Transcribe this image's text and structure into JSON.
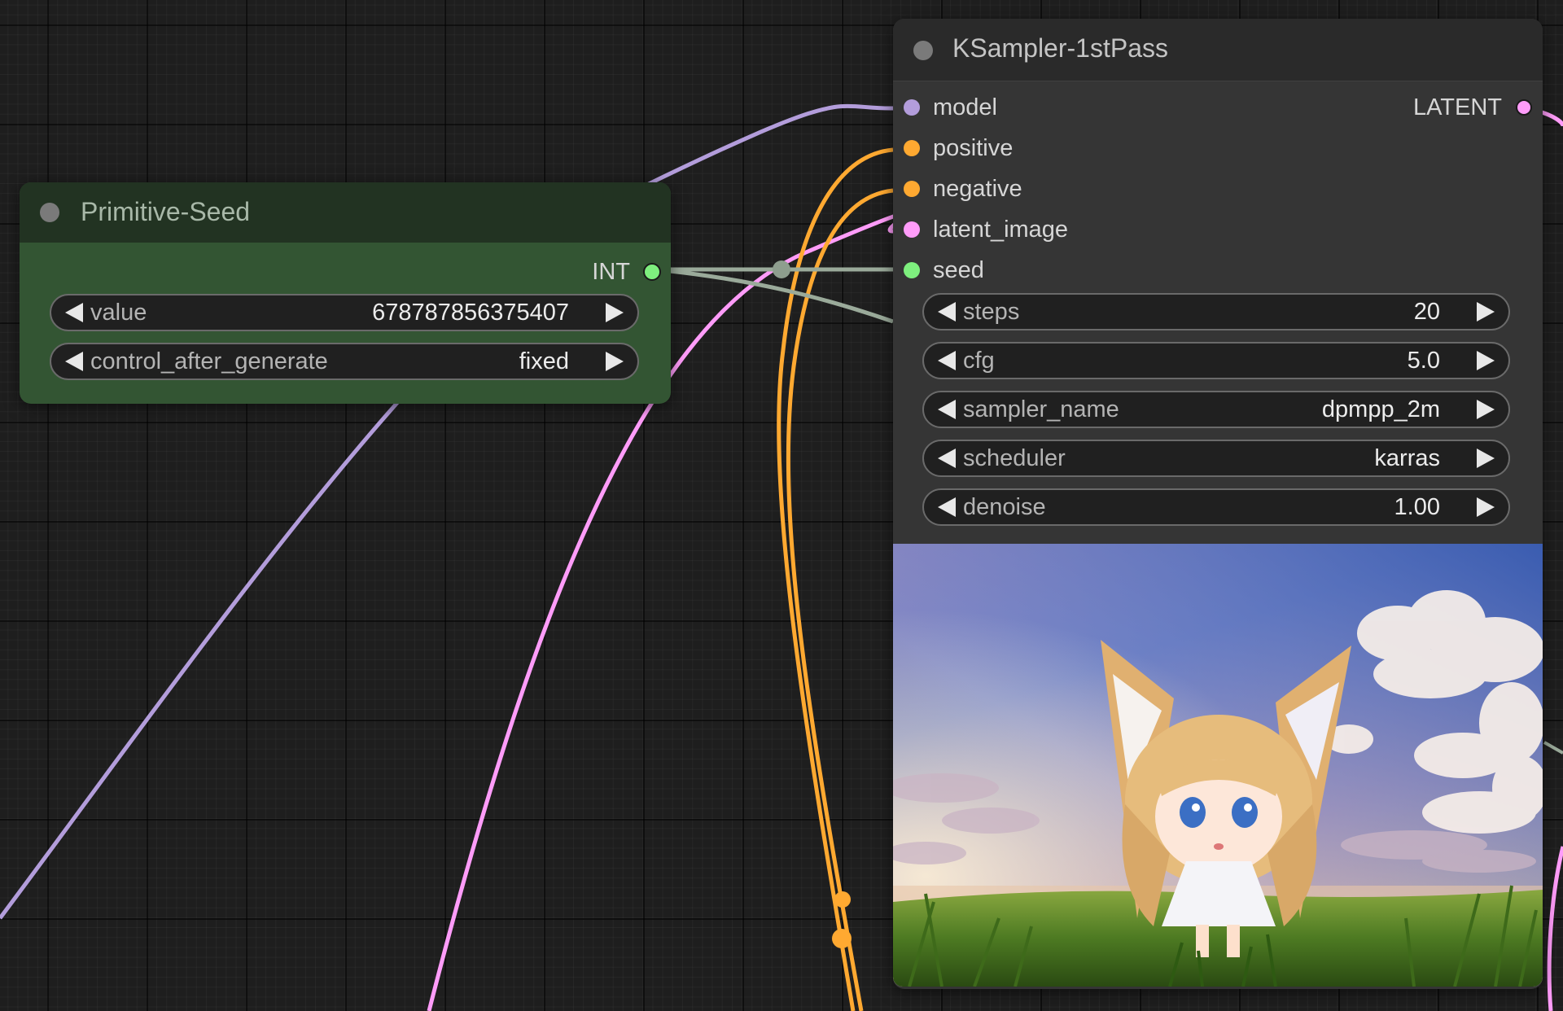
{
  "colors": {
    "model": "#b39ddb",
    "conditioning": "#ffa931",
    "latent": "#ff9cf9",
    "int": "#7eef7e",
    "seed_link": "#9aaa9a",
    "primitive_body": "#335533",
    "primitive_title": "#223322",
    "ksampler_body": "#353535",
    "ksampler_title": "#2a2a2a"
  },
  "primitive_node": {
    "title": "Primitive-Seed",
    "output_label": "INT",
    "widgets": [
      {
        "label": "value",
        "value": "678787856375407"
      },
      {
        "label": "control_after_generate",
        "value": "fixed"
      }
    ]
  },
  "ksampler_node": {
    "title": "KSampler-1stPass",
    "inputs": [
      {
        "label": "model",
        "type": "model"
      },
      {
        "label": "positive",
        "type": "conditioning"
      },
      {
        "label": "negative",
        "type": "conditioning"
      },
      {
        "label": "latent_image",
        "type": "latent"
      },
      {
        "label": "seed",
        "type": "int"
      }
    ],
    "output_label": "LATENT",
    "widgets": [
      {
        "label": "steps",
        "value": "20"
      },
      {
        "label": "cfg",
        "value": "5.0"
      },
      {
        "label": "sampler_name",
        "value": "dpmpp_2m"
      },
      {
        "label": "scheduler",
        "value": "karras"
      },
      {
        "label": "denoise",
        "value": "1.00"
      }
    ],
    "preview_icon": "fox-girl-anime-preview"
  }
}
